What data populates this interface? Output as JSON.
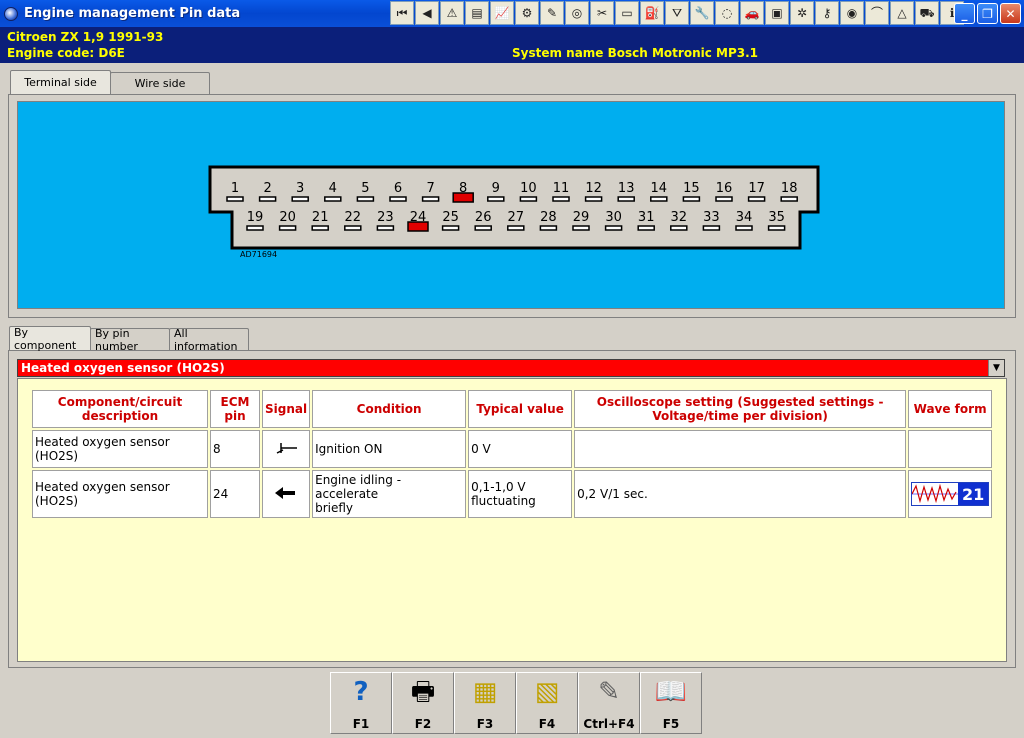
{
  "window": {
    "title": "Engine management Pin data"
  },
  "header": {
    "vehicle": "Citroen  ZX  1,9  1991-93",
    "engine": "Engine code: D6E",
    "system": "System name Bosch Motronic MP3.1"
  },
  "view_tabs": [
    {
      "label": "Terminal side",
      "active": true
    },
    {
      "label": "Wire side",
      "active": false
    }
  ],
  "connector": {
    "label": "AD71694",
    "row1": [
      1,
      2,
      3,
      4,
      5,
      6,
      7,
      8,
      9,
      10,
      11,
      12,
      13,
      14,
      15,
      16,
      17,
      18
    ],
    "row2": [
      19,
      20,
      21,
      22,
      23,
      24,
      25,
      26,
      27,
      28,
      29,
      30,
      31,
      32,
      33,
      34,
      35
    ],
    "highlighted": [
      8,
      24
    ],
    "highlight_color": "#e00000",
    "background_color": "#00aeef"
  },
  "info_tabs": [
    {
      "label": "By component",
      "active": true
    },
    {
      "label": "By pin number",
      "active": false
    },
    {
      "label": "All information",
      "active": false
    }
  ],
  "component_select": {
    "selected": "Heated oxygen sensor (HO2S)"
  },
  "table": {
    "headers": {
      "component_l1": "Component/circuit",
      "component_l2": "description",
      "pin_l1": "ECM",
      "pin_l2": "pin",
      "signal": "Signal",
      "condition": "Condition",
      "typical": "Typical value",
      "scope_l1": "Oscilloscope setting (Suggested settings -",
      "scope_l2": "Voltage/time per division)",
      "waveform": "Wave form"
    },
    "rows": [
      {
        "component_l1": "Heated oxygen sensor",
        "component_l2": "(HO2S)",
        "pin": "8",
        "signal_icon": "ground-output-icon",
        "condition_l1": "Ignition ON",
        "condition_l2": "",
        "typical_l1": "0 V",
        "typical_l2": "",
        "scope": "",
        "waveform": ""
      },
      {
        "component_l1": "Heated oxygen sensor",
        "component_l2": "(HO2S)",
        "pin": "24",
        "signal_icon": "input-arrow-icon",
        "condition_l1": "Engine idling - accelerate",
        "condition_l2": "briefly",
        "typical_l1": "0,1-1,0 V",
        "typical_l2": "fluctuating",
        "scope": "0,2 V/1 sec.",
        "waveform": "21"
      }
    ]
  },
  "function_keys": [
    {
      "label": "F1",
      "icon": "help-icon"
    },
    {
      "label": "F2",
      "icon": "print-icon"
    },
    {
      "label": "F3",
      "icon": "view-document-icon"
    },
    {
      "label": "F4",
      "icon": "search-document-icon"
    },
    {
      "label": "Ctrl+F4",
      "icon": "edit-document-icon"
    },
    {
      "label": "F5",
      "icon": "book-icon"
    }
  ],
  "toolbar_icons": [
    "first-icon",
    "previous-icon",
    "warning-icon",
    "document-icon",
    "chart-icon",
    "gear-icon",
    "tool-icon",
    "wheel-icon",
    "tools-icon",
    "battery-icon",
    "fuel-icon",
    "road-icon",
    "spanner-icon",
    "belt-icon",
    "car-icon",
    "engine-icon",
    "fan-icon",
    "key-icon",
    "camera-icon",
    "wiper-icon",
    "triangle-icon",
    "vehicle-icon",
    "info-icon"
  ]
}
